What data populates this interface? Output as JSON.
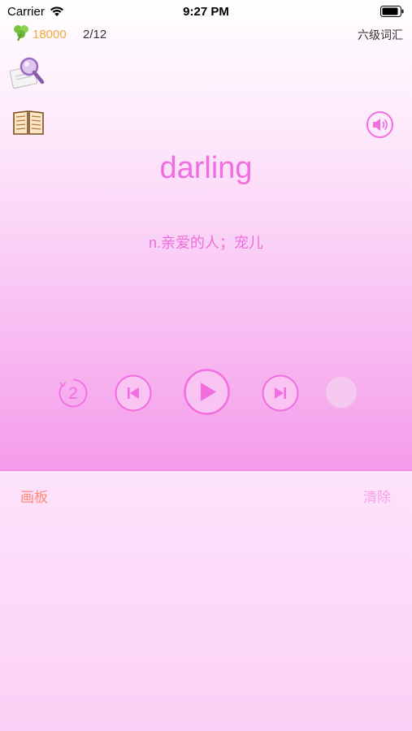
{
  "status_bar": {
    "carrier": "Carrier",
    "time": "9:27 PM"
  },
  "header": {
    "coins": "18000",
    "progress": "2/12",
    "vocab_title": "六级词汇"
  },
  "card": {
    "word": "darling",
    "meaning": "n.亲爱的人；宠儿"
  },
  "controls": {
    "repeat_count": "2"
  },
  "board": {
    "label": "画板",
    "clear_label": "清除"
  },
  "colors": {
    "accent": "#f06ee0",
    "coins": "#f2a93b",
    "board_label": "#ff8a7a"
  }
}
